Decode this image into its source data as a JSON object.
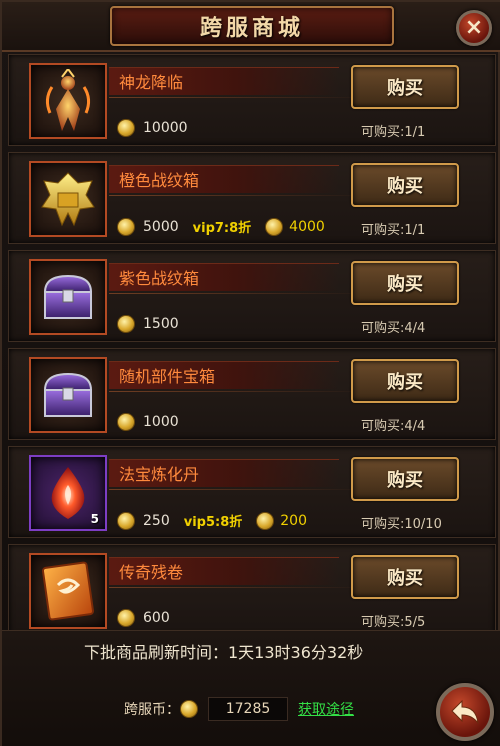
{
  "header": {
    "title": "跨服商城",
    "close_glyph": "×"
  },
  "items": [
    {
      "name": "神龙降临",
      "icon": "golden-dragon-figure-icon",
      "price": "10000",
      "buy_label": "购买",
      "limit": "可购买:1/1"
    },
    {
      "name": "橙色战纹箱",
      "icon": "orange-crystal-chest-icon",
      "price": "5000",
      "vip": "vip7:8折",
      "discount_price": "4000",
      "buy_label": "购买",
      "limit": "可购买:1/1"
    },
    {
      "name": "紫色战纹箱",
      "icon": "purple-chest-icon",
      "price": "1500",
      "buy_label": "购买",
      "limit": "可购买:4/4"
    },
    {
      "name": "随机部件宝箱",
      "icon": "purple-chest-icon",
      "price": "1000",
      "buy_label": "购买",
      "limit": "可购买:4/4"
    },
    {
      "name": "法宝炼化丹",
      "icon": "red-flame-gem-icon",
      "icon_count": "5",
      "price": "250",
      "vip": "vip5:8折",
      "discount_price": "200",
      "buy_label": "购买",
      "limit": "可购买:10/10"
    },
    {
      "name": "传奇残卷",
      "icon": "orange-scroll-icon",
      "price": "600",
      "buy_label": "购买",
      "limit": "可购买:5/5"
    }
  ],
  "footer": {
    "refresh": "下批商品刷新时间：1天13时36分32秒",
    "currency_label": "跨服币：",
    "currency_value": "17285",
    "get_link": "获取途径"
  },
  "colors": {
    "item_name": "#ff8a3d",
    "vip": "#f0d000",
    "link": "#33e046"
  }
}
